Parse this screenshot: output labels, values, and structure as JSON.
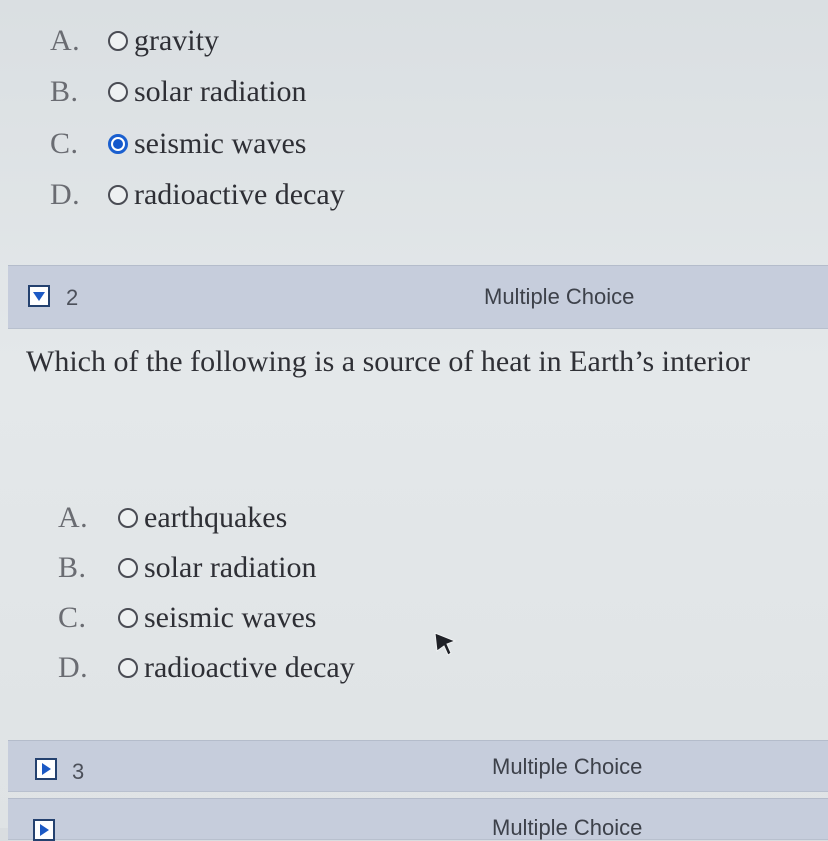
{
  "previous_question": {
    "options": [
      {
        "letter": "A.",
        "text": "gravity",
        "selected": false
      },
      {
        "letter": "B.",
        "text": "solar radiation",
        "selected": false
      },
      {
        "letter": "C.",
        "text": "seismic waves",
        "selected": true
      },
      {
        "letter": "D.",
        "text": "radioactive decay",
        "selected": false
      }
    ]
  },
  "question2": {
    "number": "2",
    "type": "Multiple Choice",
    "text": "Which of the following is a source of heat in Earth’s interior",
    "options": [
      {
        "letter": "A.",
        "text": "earthquakes",
        "selected": false
      },
      {
        "letter": "B.",
        "text": "solar radiation",
        "selected": false
      },
      {
        "letter": "C.",
        "text": "seismic waves",
        "selected": false
      },
      {
        "letter": "D.",
        "text": "radioactive decay",
        "selected": false
      }
    ]
  },
  "question3": {
    "number": "3",
    "type": "Multiple Choice"
  },
  "question4": {
    "type": "Multiple Choice"
  },
  "colors": {
    "bar": "#c6cddc",
    "selected_radio": "#1458cc",
    "background": "#e2e6e8"
  }
}
